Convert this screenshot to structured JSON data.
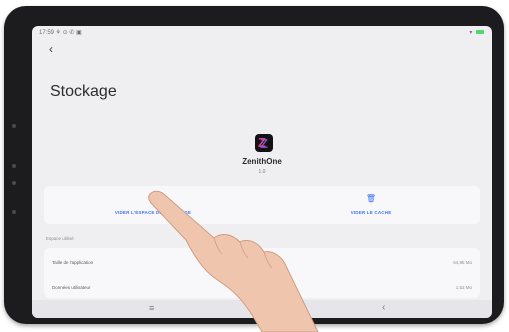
{
  "status_bar": {
    "time": "17:59 ⚘ ⊙ ✆ ▣",
    "signal": "▾"
  },
  "nav": {
    "back_glyph": "‹"
  },
  "page": {
    "title": "Stockage"
  },
  "app": {
    "name": "ZenithOne",
    "version": "1.0",
    "icon_letter": "Z"
  },
  "actions": {
    "clear_storage": {
      "label": "VIDER L'ESPACE DE STOCKAGE",
      "icon": "storage-icon",
      "glyph": "▢"
    },
    "clear_cache": {
      "label": "VIDER LE CACHE",
      "icon": "trash-icon",
      "glyph": "🗑"
    }
  },
  "usage": {
    "section_label": "Espace utilisé",
    "rows": [
      {
        "label": "Taille de l'application",
        "value": "64,85 Mo"
      },
      {
        "label": "Données utilisateur",
        "value": "1,53 Mo"
      }
    ]
  },
  "system_nav": {
    "menu_glyph": "≡",
    "back_glyph": "‹"
  },
  "colors": {
    "accent": "#3d73f5",
    "screen_bg": "#efeff2",
    "card_bg": "#f8f8fa",
    "bezel": "#1c1c1e"
  }
}
